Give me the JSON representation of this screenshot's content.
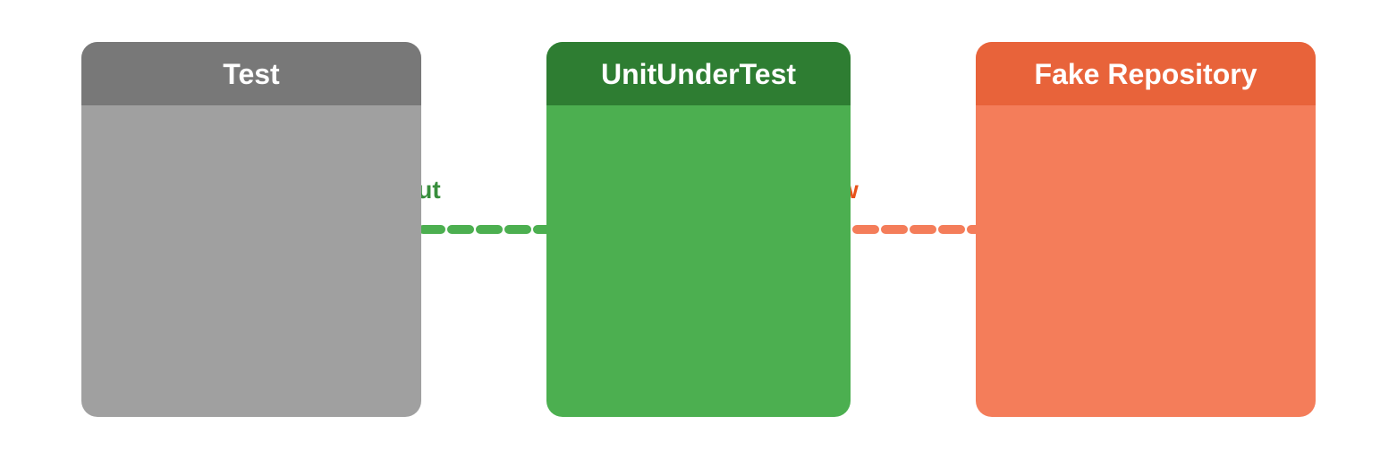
{
  "boxes": {
    "test": {
      "title": "Test",
      "header_bg": "#787878",
      "body_bg": "#a0a0a0"
    },
    "uut": {
      "title": "UnitUnderTest",
      "header_bg": "#2e7d32",
      "body_bg": "#4caf50"
    },
    "fake": {
      "title": "Fake Repository",
      "header_bg": "#e8633a",
      "body_bg": "#f47d5a"
    }
  },
  "connectors": {
    "output_label": "Output",
    "flow_label": "Flow"
  },
  "colors": {
    "green_line": "#4caf50",
    "orange_line": "#f47d5a",
    "white": "#ffffff",
    "output_text": "#388e3c",
    "flow_text": "#e8521a"
  }
}
